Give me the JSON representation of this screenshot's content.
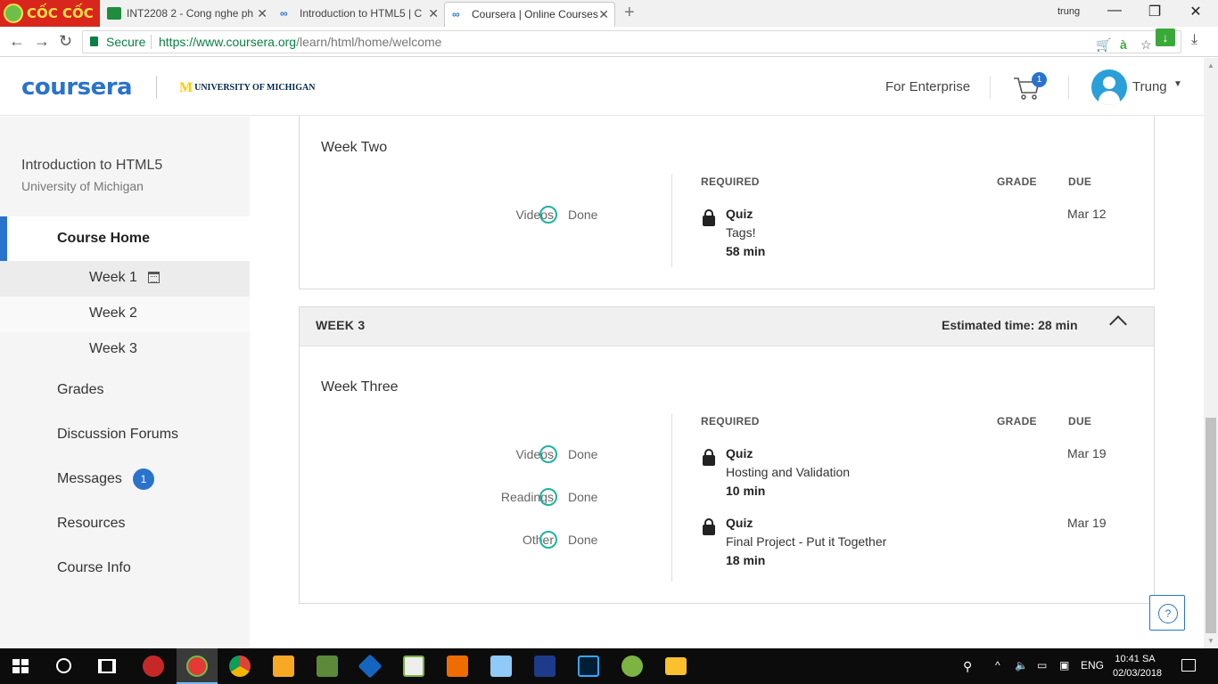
{
  "browser": {
    "brand_name": "CỐC CỐC",
    "tabs": [
      {
        "title": "INT2208 2 - Cong nghe ph",
        "icon": "spreadsheet-icon"
      },
      {
        "title": "Introduction to HTML5 | C",
        "icon": "coursera-icon"
      },
      {
        "title": "Coursera | Online Courses",
        "icon": "coursera-icon",
        "active": true
      }
    ],
    "window_user": "trung",
    "secure_label": "Secure",
    "url_host": "https://www.coursera.org",
    "url_path": "/learn/html/home/welcome"
  },
  "header": {
    "brand": "coursera",
    "partner": "UNIVERSITY OF MICHIGAN",
    "enterprise_link": "For Enterprise",
    "cart_count": "1",
    "user_name": "Trung"
  },
  "sidebar": {
    "course_title": "Introduction to HTML5",
    "course_university": "University of Michigan",
    "home_label": "Course Home",
    "weeks": [
      "Week 1",
      "Week 2",
      "Week 3"
    ],
    "items": [
      {
        "label": "Grades"
      },
      {
        "label": "Discussion Forums"
      },
      {
        "label": "Messages",
        "badge": "1"
      },
      {
        "label": "Resources"
      },
      {
        "label": "Course Info"
      }
    ]
  },
  "main": {
    "columns": {
      "required": "REQUIRED",
      "grade": "GRADE",
      "due": "DUE"
    },
    "week2": {
      "name": "Week Two",
      "progress": [
        {
          "label": "Videos",
          "status": "Done"
        }
      ],
      "items": [
        {
          "type": "Quiz",
          "name": "Tags!",
          "time": "58 min",
          "due": "Mar 12"
        }
      ]
    },
    "week3": {
      "header_label": "WEEK 3",
      "estimated": "Estimated time: 28 min",
      "name": "Week Three",
      "progress": [
        {
          "label": "Videos",
          "status": "Done"
        },
        {
          "label": "Readings",
          "status": "Done"
        },
        {
          "label": "Other",
          "status": "Done"
        }
      ],
      "items": [
        {
          "type": "Quiz",
          "name": "Hosting and Validation",
          "time": "10 min",
          "due": "Mar 19"
        },
        {
          "type": "Quiz",
          "name": "Final Project - Put it Together",
          "time": "18 min",
          "due": "Mar 19"
        }
      ]
    },
    "help_label": "?"
  },
  "taskbar": {
    "language": "ENG",
    "time": "10:41 SA",
    "date": "02/03/2018"
  },
  "colors": {
    "accent": "#2a73cc",
    "done_ring": "#1fb3a1",
    "secure_green": "#0b8043"
  }
}
